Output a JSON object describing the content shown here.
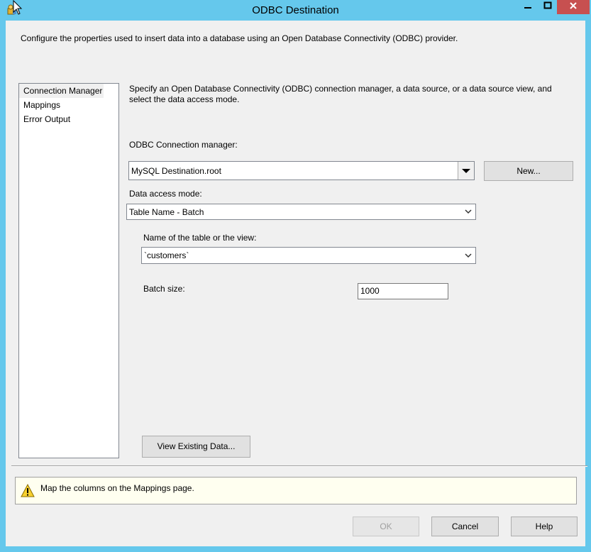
{
  "window": {
    "title": "ODBC Destination"
  },
  "header": {
    "description": "Configure the properties used to insert data into a database using an Open Database Connectivity (ODBC) provider."
  },
  "nav": {
    "items": [
      {
        "label": "Connection Manager"
      },
      {
        "label": "Mappings"
      },
      {
        "label": "Error Output"
      }
    ]
  },
  "main": {
    "intro": "Specify an Open Database Connectivity (ODBC) connection manager, a data source, or a data source view, and select the data access mode.",
    "conn_label": "ODBC Connection manager:",
    "conn_value": "MySQL Destination.root",
    "new_button": "New...",
    "access_label": "Data access mode:",
    "access_value": "Table Name - Batch",
    "table_label": "Name of the table or the view:",
    "table_value": "`customers`",
    "batch_label": "Batch size:",
    "batch_value": "1000",
    "view_button": "View Existing Data..."
  },
  "message": {
    "text": "Map the columns on the Mappings page."
  },
  "footer": {
    "ok": "OK",
    "cancel": "Cancel",
    "help": "Help"
  },
  "colors": {
    "frame": "#65c8ec",
    "close": "#c75050",
    "message_bg": "#fffff0"
  }
}
